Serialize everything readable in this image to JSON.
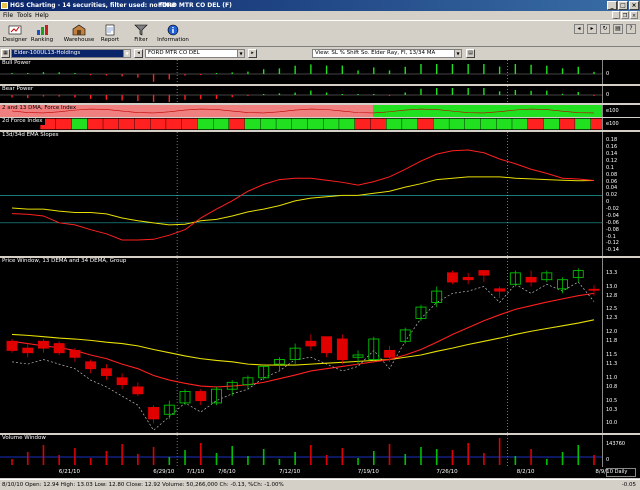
{
  "window": {
    "title_left": "HGS Charting - 14 securities, filter used: no filter",
    "title_right": "FORD MTR CO DEL (F)"
  },
  "menu": [
    "File",
    "Tools",
    "Help"
  ],
  "toolbar": {
    "buttons": [
      "Designer",
      "Ranking",
      "Warehouse",
      "Report",
      "Filter",
      "Information"
    ]
  },
  "selectors": {
    "watchlist": "Elder-100UL13-Holdings",
    "security": "FORD MTR CO DEL",
    "view": "View: SL % Shift So. Elder Ray, FI, 13/34 MA"
  },
  "panels": {
    "bull_power": {
      "title": "Bull Power",
      "axis": [
        "0"
      ]
    },
    "bear_power": {
      "title": "Bear Power",
      "axis": [
        "0"
      ]
    },
    "force_index_2_13": {
      "title": "2 and 13 DMA, Force Index",
      "axis": [
        "e100"
      ]
    },
    "force_index_2d": {
      "title": "2d Force Index",
      "axis": [
        "e100"
      ]
    },
    "ema_slopes": {
      "title": "13d/34d EMA Slopes",
      "axis": [
        "0.18",
        "0.16",
        "0.14",
        "0.12",
        "0.1",
        "0.08",
        "0.06",
        "0.04",
        "0.02",
        "0",
        "-0.02",
        "-0.04",
        "-0.06",
        "-0.08",
        "-0.1",
        "-0.12",
        "-0.14"
      ]
    },
    "price": {
      "title": "Price Window, 13 DEMA and 34 DEMA, Group",
      "axis": [
        "13.3",
        "13.0",
        "12.8",
        "12.5",
        "12.3",
        "12.0",
        "11.8",
        "11.5",
        "11.3",
        "11.0",
        "10.8",
        "10.5",
        "10.3",
        "10.0"
      ]
    },
    "volume": {
      "title": "Volume Window",
      "axis": [
        "143760",
        "0"
      ]
    }
  },
  "dates": [
    "6/21/10",
    "6/29/10",
    "7/1/10",
    "7/6/10",
    "7/12/10",
    "7/19/10",
    "7/26/10",
    "8/2/10",
    "8/9/10"
  ],
  "days_label": "Daily",
  "status": {
    "text": "8/10/10  Open: 12.94  High: 13.03  Low: 12.80  Close: 12.92  Volume: 50,266,000  Ch: -0.13, %Ch: -1.00%",
    "right": "-0.05"
  },
  "colors": {
    "up_candle": "#00c000",
    "down_candle": "#e00000",
    "ema13": "#ff2020",
    "ema34": "#e8e000",
    "force_green": "#20e020",
    "force_red": "#ff2020",
    "force_pink": "#f08080"
  },
  "chart_data": {
    "type": "candlestick",
    "title": "Price Window, 13 DEMA and 34 DEMA, Group",
    "x": [
      "6/17",
      "6/18",
      "6/21",
      "6/22",
      "6/23",
      "6/24",
      "6/25",
      "6/28",
      "6/29",
      "6/30",
      "7/1",
      "7/2",
      "7/6",
      "7/7",
      "7/8",
      "7/9",
      "7/12",
      "7/13",
      "7/14",
      "7/15",
      "7/16",
      "7/19",
      "7/20",
      "7/21",
      "7/22",
      "7/23",
      "7/26",
      "7/27",
      "7/28",
      "7/29",
      "7/30",
      "8/2",
      "8/3",
      "8/4",
      "8/5",
      "8/6",
      "8/9",
      "8/10"
    ],
    "ohlc": [
      [
        11.8,
        11.85,
        11.55,
        11.6
      ],
      [
        11.65,
        11.75,
        11.45,
        11.55
      ],
      [
        11.8,
        11.85,
        11.55,
        11.65
      ],
      [
        11.75,
        11.8,
        11.5,
        11.55
      ],
      [
        11.6,
        11.65,
        11.35,
        11.45
      ],
      [
        11.35,
        11.4,
        11.1,
        11.2
      ],
      [
        11.2,
        11.3,
        10.95,
        11.05
      ],
      [
        11.0,
        11.1,
        10.75,
        10.85
      ],
      [
        10.8,
        10.9,
        10.6,
        10.65
      ],
      [
        10.35,
        10.4,
        10.0,
        10.1
      ],
      [
        10.2,
        10.5,
        10.1,
        10.4
      ],
      [
        10.45,
        10.75,
        10.4,
        10.7
      ],
      [
        10.7,
        10.75,
        10.4,
        10.5
      ],
      [
        10.45,
        10.8,
        10.4,
        10.75
      ],
      [
        10.75,
        10.95,
        10.6,
        10.9
      ],
      [
        10.85,
        11.05,
        10.75,
        11.0
      ],
      [
        11.0,
        11.3,
        10.95,
        11.25
      ],
      [
        11.3,
        11.45,
        11.15,
        11.4
      ],
      [
        11.4,
        11.75,
        11.3,
        11.65
      ],
      [
        11.8,
        11.95,
        11.6,
        11.7
      ],
      [
        11.9,
        11.9,
        11.45,
        11.55
      ],
      [
        11.85,
        11.95,
        11.3,
        11.4
      ],
      [
        11.45,
        11.6,
        11.3,
        11.5
      ],
      [
        11.4,
        11.9,
        11.35,
        11.85
      ],
      [
        11.6,
        11.7,
        11.35,
        11.45
      ],
      [
        11.8,
        12.1,
        11.75,
        12.05
      ],
      [
        12.3,
        12.6,
        12.25,
        12.55
      ],
      [
        12.65,
        13.0,
        12.55,
        12.9
      ],
      [
        13.3,
        13.35,
        13.05,
        13.1
      ],
      [
        13.2,
        13.3,
        13.05,
        13.15
      ],
      [
        13.35,
        13.35,
        13.1,
        13.25
      ],
      [
        12.95,
        13.0,
        12.75,
        12.9
      ],
      [
        13.05,
        13.35,
        13.0,
        13.3
      ],
      [
        13.2,
        13.35,
        13.0,
        13.1
      ],
      [
        13.15,
        13.35,
        13.1,
        13.3
      ],
      [
        12.95,
        13.2,
        12.85,
        13.15
      ],
      [
        13.2,
        13.4,
        13.1,
        13.35
      ],
      [
        12.94,
        13.03,
        12.8,
        12.92
      ]
    ],
    "ema13": [
      11.8,
      11.75,
      11.7,
      11.66,
      11.6,
      11.5,
      11.42,
      11.3,
      11.2,
      11.05,
      10.95,
      10.88,
      10.82,
      10.8,
      10.82,
      10.85,
      10.9,
      10.98,
      11.06,
      11.15,
      11.2,
      11.25,
      11.3,
      11.35,
      11.4,
      11.5,
      11.62,
      11.78,
      11.95,
      12.1,
      12.25,
      12.38,
      12.5,
      12.58,
      12.66,
      12.73,
      12.8,
      12.85
    ],
    "ema34": [
      11.95,
      11.93,
      11.9,
      11.87,
      11.85,
      11.82,
      11.78,
      11.75,
      11.7,
      11.62,
      11.55,
      11.48,
      11.42,
      11.38,
      11.35,
      11.3,
      11.28,
      11.28,
      11.28,
      11.3,
      11.32,
      11.34,
      11.36,
      11.38,
      11.4,
      11.45,
      11.5,
      11.58,
      11.65,
      11.73,
      11.8,
      11.87,
      11.95,
      12.02,
      12.08,
      12.14,
      12.2,
      12.27
    ],
    "ylim": [
      9.9,
      13.45
    ]
  }
}
